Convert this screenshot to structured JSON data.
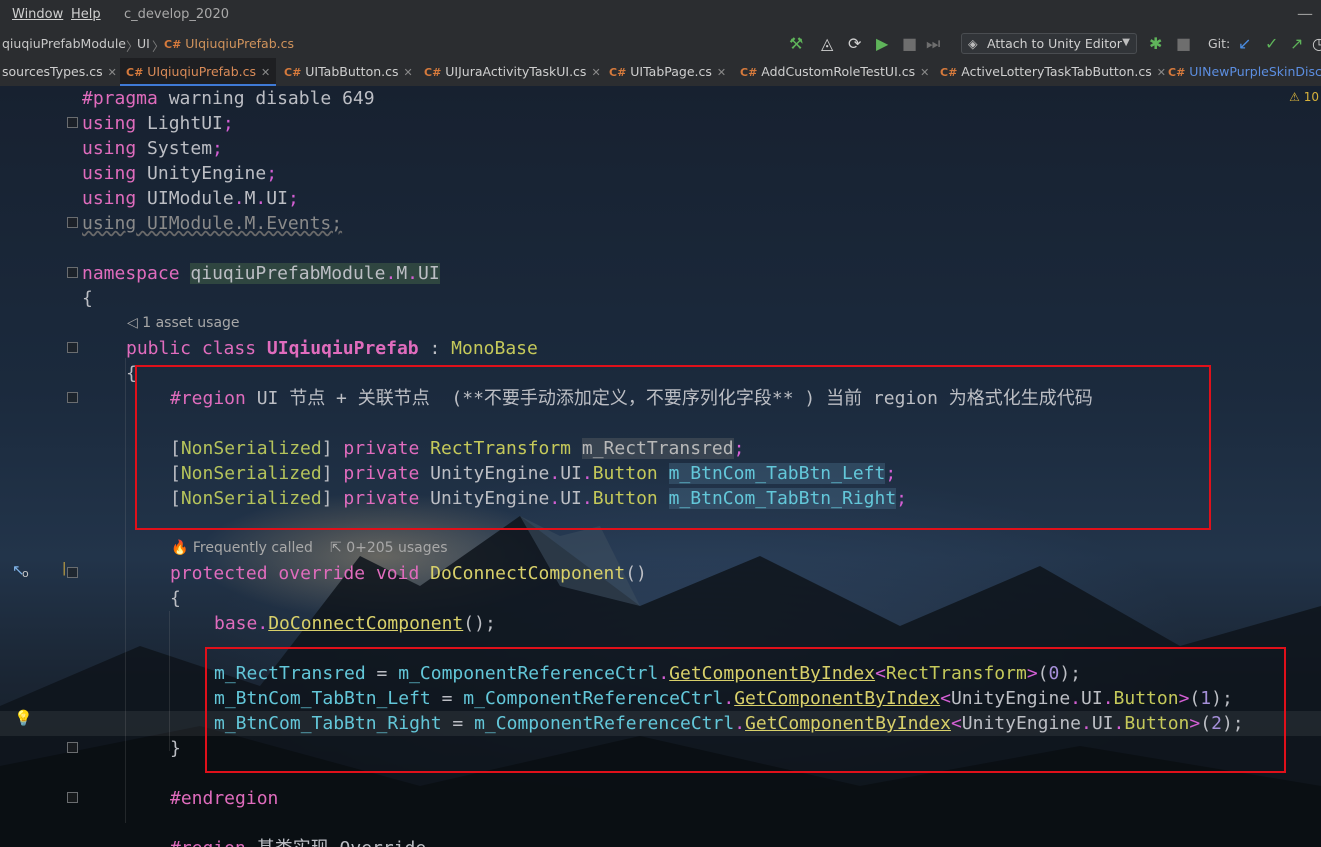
{
  "menubar": {
    "window_label": "Window",
    "help_label": "Help",
    "project_label": "c_develop_2020",
    "minimize_glyph": "—"
  },
  "breadcrumb": {
    "items": [
      "qiuqiuPrefabModule",
      "UI",
      "UIqiuqiuPrefab.cs"
    ],
    "cs_tag": "C#"
  },
  "toolbar": {
    "attach_label": "Attach to Unity Editor",
    "git_label": "Git:"
  },
  "tabs": [
    {
      "label": "sourcesTypes.cs",
      "close": "✕"
    },
    {
      "label": "UIqiuqiuPrefab.cs",
      "close": "✕"
    },
    {
      "label": "UITabButton.cs",
      "close": "✕"
    },
    {
      "label": "UIJuraActivityTaskUI.cs",
      "close": "✕"
    },
    {
      "label": "UITabPage.cs",
      "close": "✕"
    },
    {
      "label": "AddCustomRoleTestUI.cs",
      "close": "✕"
    },
    {
      "label": "ActiveLotteryTaskTabButton.cs",
      "close": "✕"
    },
    {
      "label": "UINewPurpleSkinDisco"
    }
  ],
  "warning_count": "10",
  "hints": {
    "asset_usage": "1 asset usage",
    "frequently_called": "Frequently called",
    "usages": "0+205 usages"
  },
  "code": {
    "l1_kw": "#pragma",
    "l1_rest": " warning disable 649",
    "using_kw": "using",
    "u1": " LightUI",
    "u2": " System",
    "u3": " UnityEngine",
    "u4": " UIModule",
    "u4b": "M",
    "u4c": "UI",
    "u5": " UIModule.M.Events;",
    "ns_kw": "namespace",
    "ns_a": "qiuqiuPrefabModule",
    "ns_b": "M",
    "ns_c": "UI",
    "brace_open": "{",
    "brace_close": "}",
    "semi": ";",
    "dot": ".",
    "class_public": "public",
    "class_kw": "class",
    "class_name": "UIqiuqiuPrefab",
    "class_colon": " : ",
    "class_base": "MonoBase",
    "region_kw": "#region",
    "region_text": " UI 节点 + 关联节点  (**不要手动添加定义，不要序列化字段** ) 当前 region 为格式化生成代码",
    "attr_open": "[",
    "attr_name": "NonSerialized",
    "attr_close": "]",
    "private_kw": "private",
    "t_rect": "RectTransform",
    "t_ue": "UnityEngine",
    "t_ui": "UI",
    "t_btn": "Button",
    "f_rect": "m_RectTransred",
    "f_left": "m_BtnCom_TabBtn_Left",
    "f_right": "m_BtnCom_TabBtn_Right",
    "protected_kw": "protected",
    "override_kw": "override",
    "void_kw": "void",
    "method_name": "DoConnectComponent",
    "parens": "()",
    "base_kw": "base",
    "base_call_tail": "();",
    "assign": " = ",
    "ref_ctrl": "m_ComponentReferenceCtrl",
    "get_by_index": "GetComponentByIndex",
    "lt": "<",
    "gt": ">",
    "p_open": "(",
    "p_close": ");",
    "n0": "0",
    "n1": "1",
    "n2": "2",
    "endregion_kw": "#endregion",
    "region2_text": " 基类实现 Override"
  }
}
